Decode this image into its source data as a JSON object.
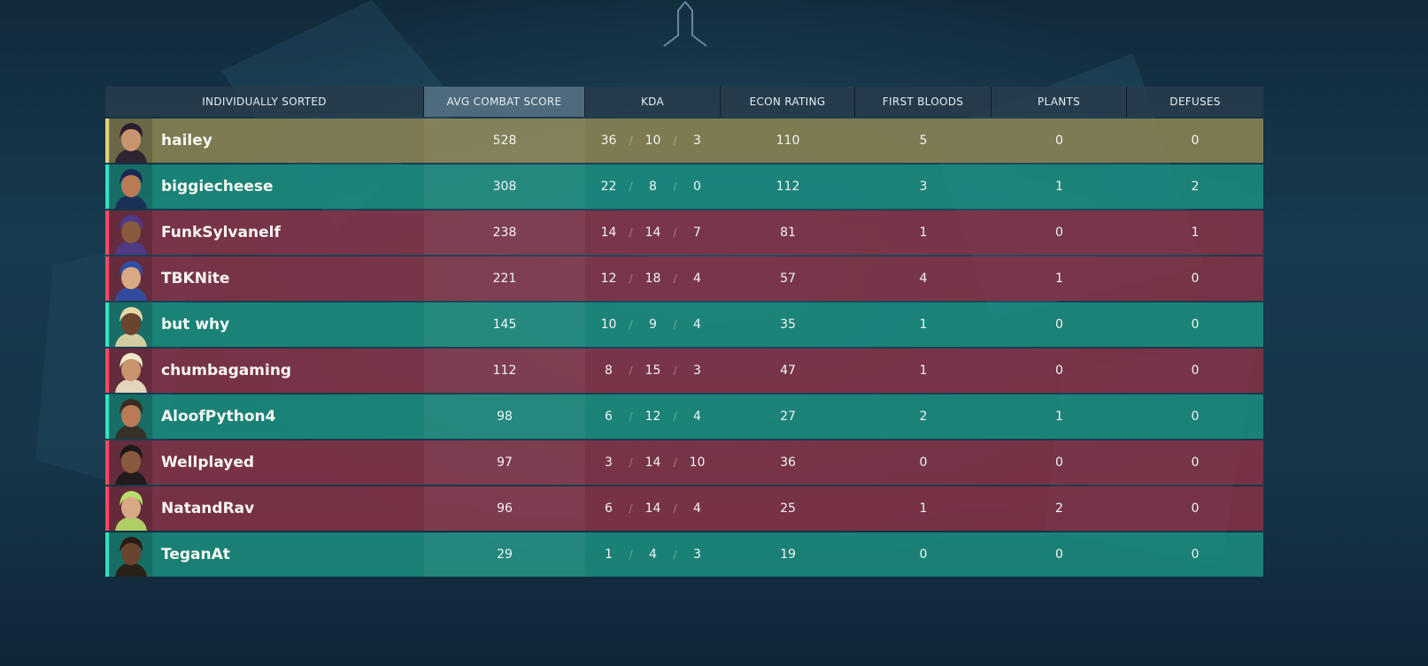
{
  "header": {
    "sort_label": "INDIVIDUALLY SORTED",
    "acs": "AVG COMBAT SCORE",
    "kda": "KDA",
    "econ": "ECON RATING",
    "first_bloods": "FIRST BLOODS",
    "plants": "PLANTS",
    "defuses": "DEFUSES"
  },
  "colors": {
    "green_team": "#1b8c7d",
    "red_team": "#8c3246",
    "highlight": "#87805a"
  },
  "players": [
    {
      "name": "hailey",
      "team": "gold",
      "acs": "528",
      "k": "36",
      "d": "10",
      "a": "3",
      "econ": "110",
      "fb": "5",
      "plants": "0",
      "defuses": "0",
      "avatar": "agent-portrait-icon"
    },
    {
      "name": "biggiecheese",
      "team": "green",
      "acs": "308",
      "k": "22",
      "d": "8",
      "a": "0",
      "econ": "112",
      "fb": "3",
      "plants": "1",
      "defuses": "2",
      "avatar": "agent-portrait-icon"
    },
    {
      "name": "FunkSylvanelf",
      "team": "red",
      "acs": "238",
      "k": "14",
      "d": "14",
      "a": "7",
      "econ": "81",
      "fb": "1",
      "plants": "0",
      "defuses": "1",
      "avatar": "agent-portrait-icon"
    },
    {
      "name": "TBKNite",
      "team": "red",
      "acs": "221",
      "k": "12",
      "d": "18",
      "a": "4",
      "econ": "57",
      "fb": "4",
      "plants": "1",
      "defuses": "0",
      "avatar": "agent-portrait-icon"
    },
    {
      "name": "but why",
      "team": "green",
      "acs": "145",
      "k": "10",
      "d": "9",
      "a": "4",
      "econ": "35",
      "fb": "1",
      "plants": "0",
      "defuses": "0",
      "avatar": "agent-portrait-icon"
    },
    {
      "name": "chumbagaming",
      "team": "red",
      "acs": "112",
      "k": "8",
      "d": "15",
      "a": "3",
      "econ": "47",
      "fb": "1",
      "plants": "0",
      "defuses": "0",
      "avatar": "agent-portrait-icon"
    },
    {
      "name": "AloofPython4",
      "team": "green",
      "acs": "98",
      "k": "6",
      "d": "12",
      "a": "4",
      "econ": "27",
      "fb": "2",
      "plants": "1",
      "defuses": "0",
      "avatar": "agent-portrait-icon"
    },
    {
      "name": "Wellplayed",
      "team": "red",
      "acs": "97",
      "k": "3",
      "d": "14",
      "a": "10",
      "econ": "36",
      "fb": "0",
      "plants": "0",
      "defuses": "0",
      "avatar": "agent-portrait-icon"
    },
    {
      "name": "NatandRav",
      "team": "red",
      "acs": "96",
      "k": "6",
      "d": "14",
      "a": "4",
      "econ": "25",
      "fb": "1",
      "plants": "2",
      "defuses": "0",
      "avatar": "agent-portrait-icon"
    },
    {
      "name": "TeganAt",
      "team": "green",
      "acs": "29",
      "k": "1",
      "d": "4",
      "a": "3",
      "econ": "19",
      "fb": "0",
      "plants": "0",
      "defuses": "0",
      "avatar": "agent-portrait-icon"
    }
  ]
}
